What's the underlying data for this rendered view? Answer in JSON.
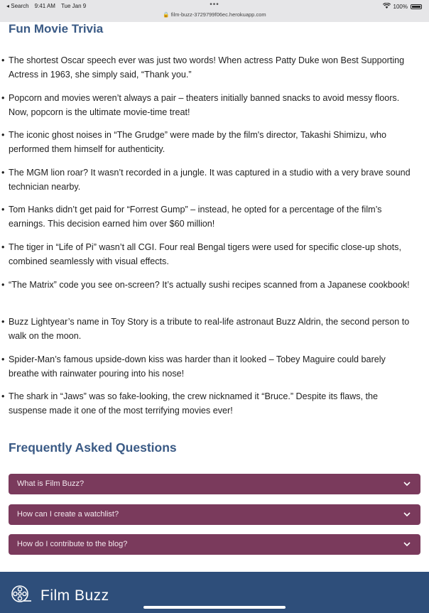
{
  "status_bar": {
    "back_label": "◂ Search",
    "time": "9:41 AM",
    "date": "Tue Jan 9",
    "dots": "•••",
    "url": "🔒 film-buzz-3729799f06ec.herokuapp.com",
    "battery": "100%"
  },
  "trivia": {
    "heading": "Fun Movie Trivia",
    "bullet": "•",
    "items": [
      "The shortest Oscar speech ever was just two words! When actress Patty Duke won Best Supporting Actress in 1963, she simply said, “Thank you.”",
      "Popcorn and movies weren’t always a pair – theaters initially banned snacks to avoid messy floors. Now, popcorn is the ultimate movie-time treat!",
      "The iconic ghost noises in “The Grudge” were made by the film's director, Takashi Shimizu, who performed them himself for authenticity.",
      "The MGM lion roar? It wasn’t recorded in a jungle. It was captured in a studio with a very brave sound technician nearby.",
      "Tom Hanks didn’t get paid for “Forrest Gump” – instead, he opted for a percentage of the film’s earnings. This decision earned him over $60 million!",
      "The tiger in “Life of Pi” wasn’t all CGI. Four real Bengal tigers were used for specific close-up shots, combined seamlessly with visual effects.",
      "“The Matrix” code you see on-screen? It’s actually sushi recipes scanned from a Japanese cookbook!",
      "Buzz Lightyear’s name in Toy Story is a tribute to real-life astronaut Buzz Aldrin, the second person to walk on the moon.",
      "Spider-Man’s famous upside-down kiss was harder than it looked – Tobey Maguire could barely breathe with rainwater pouring into his nose!",
      "The shark in “Jaws” was so fake-looking, the crew nicknamed it “Bruce.” Despite its flaws, the suspense made it one of the most terrifying movies ever!"
    ]
  },
  "faq": {
    "heading": "Frequently Asked Questions",
    "items": [
      {
        "question": "What is Film Buzz?"
      },
      {
        "question": "How can I create a watchlist?"
      },
      {
        "question": "How do I contribute to the blog?"
      }
    ]
  },
  "footer": {
    "brand": "Film Buzz",
    "logo_icon": "film-reel-icon"
  },
  "colors": {
    "heading": "#3a5a85",
    "faq_bg": "#7a3a5c",
    "footer_bg": "#2e4e7a"
  }
}
